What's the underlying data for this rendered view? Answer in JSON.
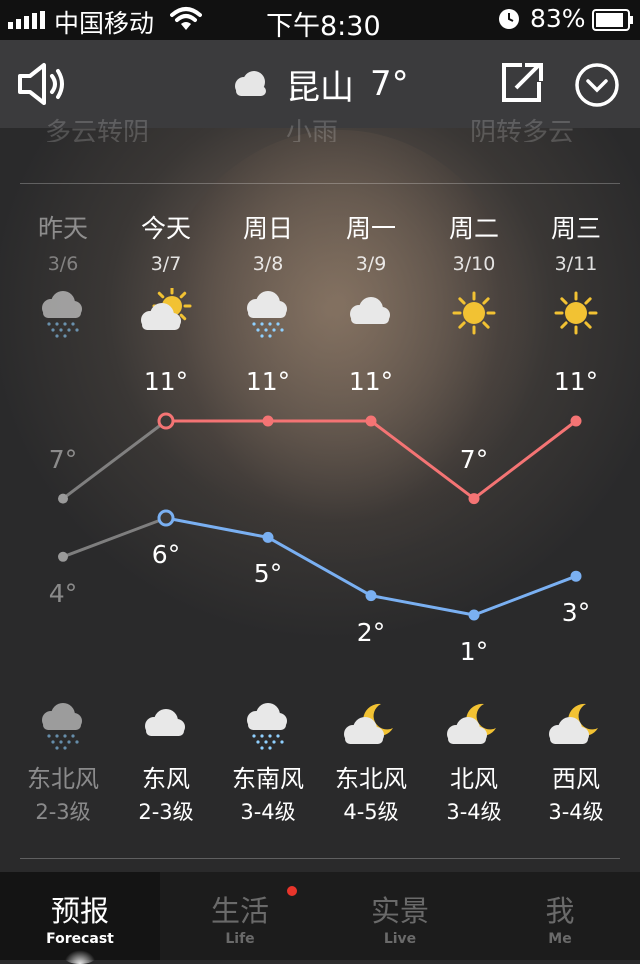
{
  "status_bar": {
    "carrier": "中国移动",
    "time": "下午8:30",
    "battery": "83%"
  },
  "header": {
    "city": "昆山",
    "temperature": "7°",
    "weather_icon": "cloudy-icon"
  },
  "ghost_row": [
    "多云转阴",
    "小雨",
    "阴转多云"
  ],
  "colors": {
    "high_line": "#f47474",
    "low_line": "#7ab0f2",
    "sun": "#f2c233",
    "notification_dot": "#e8352b"
  },
  "forecast": [
    {
      "day": "昨天",
      "date": "3/6",
      "icon": "cloud-rain-icon",
      "high": "7°",
      "low": "4°",
      "night_icon": "cloud-rain-icon",
      "wind_dir": "东北风",
      "wind_level": "2-3级",
      "past": true
    },
    {
      "day": "今天",
      "date": "3/7",
      "icon": "sun-cloud-icon",
      "high": "11°",
      "low": "6°",
      "night_icon": "cloudy-icon",
      "wind_dir": "东风",
      "wind_level": "2-3级",
      "past": false
    },
    {
      "day": "周日",
      "date": "3/8",
      "icon": "cloud-rain-icon",
      "high": "11°",
      "low": "5°",
      "night_icon": "cloud-rain-icon",
      "wind_dir": "东南风",
      "wind_level": "3-4级",
      "past": false
    },
    {
      "day": "周一",
      "date": "3/9",
      "icon": "cloudy-icon",
      "high": "11°",
      "low": "2°",
      "night_icon": "moon-cloud-icon",
      "wind_dir": "东北风",
      "wind_level": "4-5级",
      "past": false
    },
    {
      "day": "周二",
      "date": "3/10",
      "icon": "sun-icon",
      "high": "7°",
      "low": "1°",
      "night_icon": "moon-cloud-icon",
      "wind_dir": "北风",
      "wind_level": "3-4级",
      "past": false
    },
    {
      "day": "周三",
      "date": "3/11",
      "icon": "sun-icon",
      "high": "11°",
      "low": "3°",
      "night_icon": "moon-cloud-icon",
      "wind_dir": "西风",
      "wind_level": "3-4级",
      "past": false
    }
  ],
  "chart_data": {
    "type": "line",
    "categories": [
      "3/6",
      "3/7",
      "3/8",
      "3/9",
      "3/10",
      "3/11"
    ],
    "series": [
      {
        "values": [
          7,
          11,
          11,
          11,
          7,
          11
        ]
      },
      {
        "values": [
          4,
          6,
          5,
          2,
          1,
          3
        ]
      }
    ]
  },
  "tabs": [
    {
      "label": "预报",
      "sublabel": "Forecast",
      "active": true
    },
    {
      "label": "生活",
      "sublabel": "Life",
      "active": false,
      "badge": true
    },
    {
      "label": "实景",
      "sublabel": "Live",
      "active": false
    },
    {
      "label": "我",
      "sublabel": "Me",
      "active": false
    }
  ]
}
